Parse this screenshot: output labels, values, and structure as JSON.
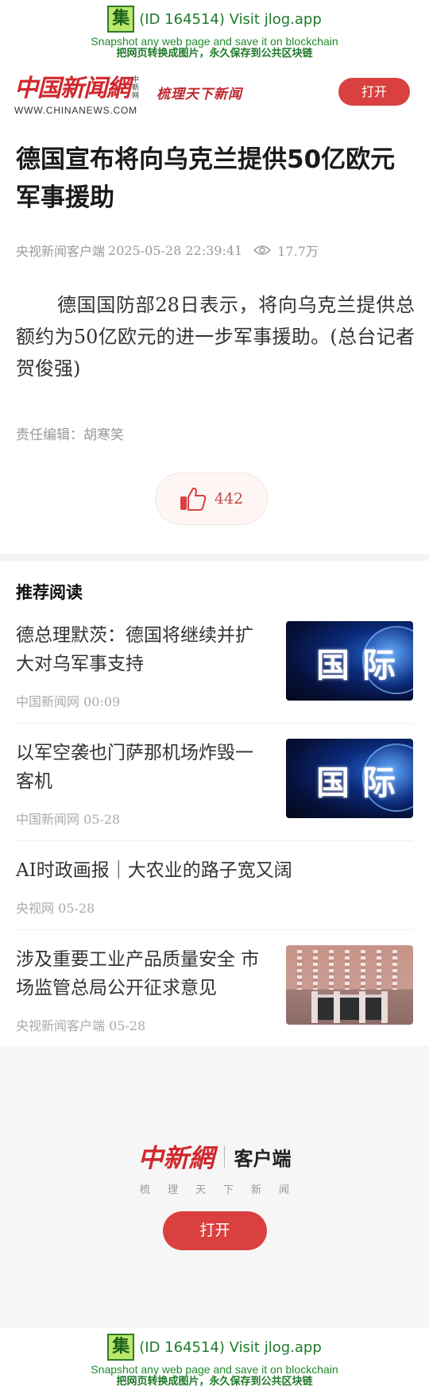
{
  "jlog": {
    "badge": "集",
    "title": "(ID 164514) Visit jlog.app",
    "line_en": "Snapshot any web page and save it on blockchain",
    "line_cn": "把网页转换成图片，永久保存到公共区块链"
  },
  "header": {
    "logo_text": "中国新闻網",
    "logo_small": "中新网",
    "logo_url": "WWW.CHINANEWS.COM",
    "slogan": "梳理天下新闻",
    "open_label": "打开"
  },
  "article": {
    "title": "德国宣布将向乌克兰提供50亿欧元军事援助",
    "source": "央视新闻客户端",
    "datetime": "2025-05-28 22:39:41",
    "views": "17.7万",
    "body": "德国国防部28日表示，将向乌克兰提供总额约为50亿欧元的进一步军事援助。(总台记者 贺俊强)",
    "editor": "责任编辑：胡寒笑",
    "likes": "442"
  },
  "recommend": {
    "heading": "推荐阅读",
    "items": [
      {
        "title": "德总理默茨：德国将继续并扩大对乌军事支持",
        "meta": "中国新闻网 00:09",
        "thumb": "国际"
      },
      {
        "title": "以军空袭也门萨那机场炸毁一客机",
        "meta": "中国新闻网 05-28",
        "thumb": "国际"
      },
      {
        "title": "AI时政画报｜大农业的路子宽又阔",
        "meta": "央视网 05-28"
      },
      {
        "title": "涉及重要工业产品质量安全 市场监管总局公开征求意见",
        "meta": "央视新闻客户端 05-28"
      }
    ]
  },
  "promo": {
    "logo": "中新網",
    "app": "客户端",
    "sub": "梳理天下新闻",
    "open_label": "打开"
  },
  "colors": {
    "brand_red": "#d0282d",
    "button_red": "#d9403f",
    "jlog_green": "#1f7a2a"
  }
}
